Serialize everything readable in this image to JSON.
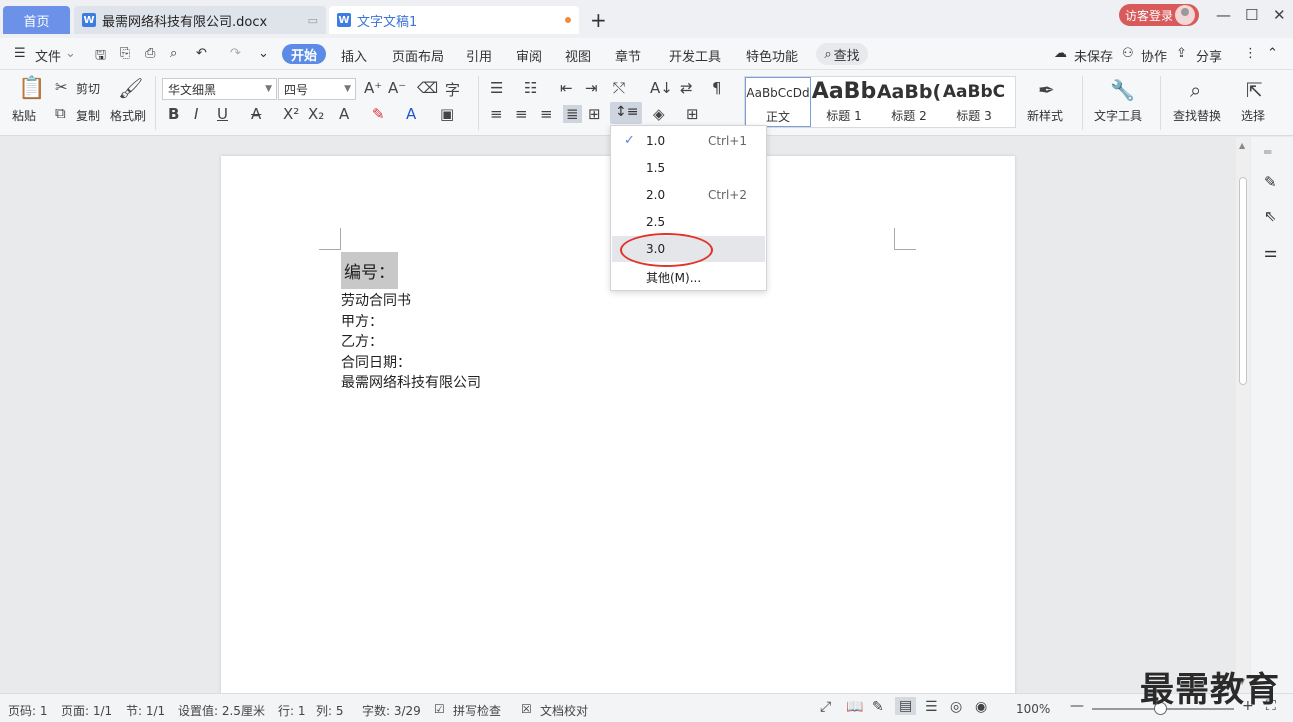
{
  "tabs": {
    "home": "首页",
    "doc1": "最需网络科技有限公司.docx",
    "doc2": "文字文稿1",
    "new_tab": "+"
  },
  "titlebar": {
    "login": "访客登录",
    "minimize": "—",
    "maximize": "☐",
    "close": "✕"
  },
  "menu": {
    "file": "文件",
    "items": [
      "开始",
      "插入",
      "页面布局",
      "引用",
      "审阅",
      "视图",
      "章节",
      "开发工具",
      "特色功能"
    ],
    "search": "查找",
    "unsaved": "未保存",
    "collab": "协作",
    "share": "分享"
  },
  "ribbon": {
    "paste": "粘贴",
    "cut": "剪切",
    "copy": "复制",
    "format_painter": "格式刷",
    "font_name": "华文细黑",
    "font_size": "四号",
    "styles": [
      {
        "sample": "AaBbCcDd",
        "label": "正文"
      },
      {
        "sample": "AaBb",
        "label": "标题 1"
      },
      {
        "sample": "AaBb(",
        "label": "标题 2"
      },
      {
        "sample": "AaBbC",
        "label": "标题 3"
      }
    ],
    "new_style": "新样式",
    "text_tools": "文字工具",
    "find_replace": "查找替换",
    "select": "选择"
  },
  "line_spacing_menu": {
    "items": [
      {
        "value": "1.0",
        "shortcut": "Ctrl+1",
        "checked": true
      },
      {
        "value": "1.5",
        "shortcut": ""
      },
      {
        "value": "2.0",
        "shortcut": "Ctrl+2"
      },
      {
        "value": "2.5",
        "shortcut": ""
      },
      {
        "value": "3.0",
        "shortcut": "",
        "hover": true
      },
      {
        "value": "其他(M)...",
        "shortcut": ""
      }
    ]
  },
  "document": {
    "heading": "编号：",
    "lines": [
      "劳动合同书",
      "甲方：",
      "乙方：",
      "合同日期：",
      "最需网络科技有限公司"
    ]
  },
  "status": {
    "page_no": "页码: 1",
    "pages": "页面: 1/1",
    "section": "节: 1/1",
    "setting": "设置值: 2.5厘米",
    "row": "行: 1",
    "col": "列: 5",
    "words": "字数: 3/29",
    "spell": "拼写检查",
    "proof": "文档校对",
    "zoom": "100%"
  },
  "watermark": "最需教育"
}
